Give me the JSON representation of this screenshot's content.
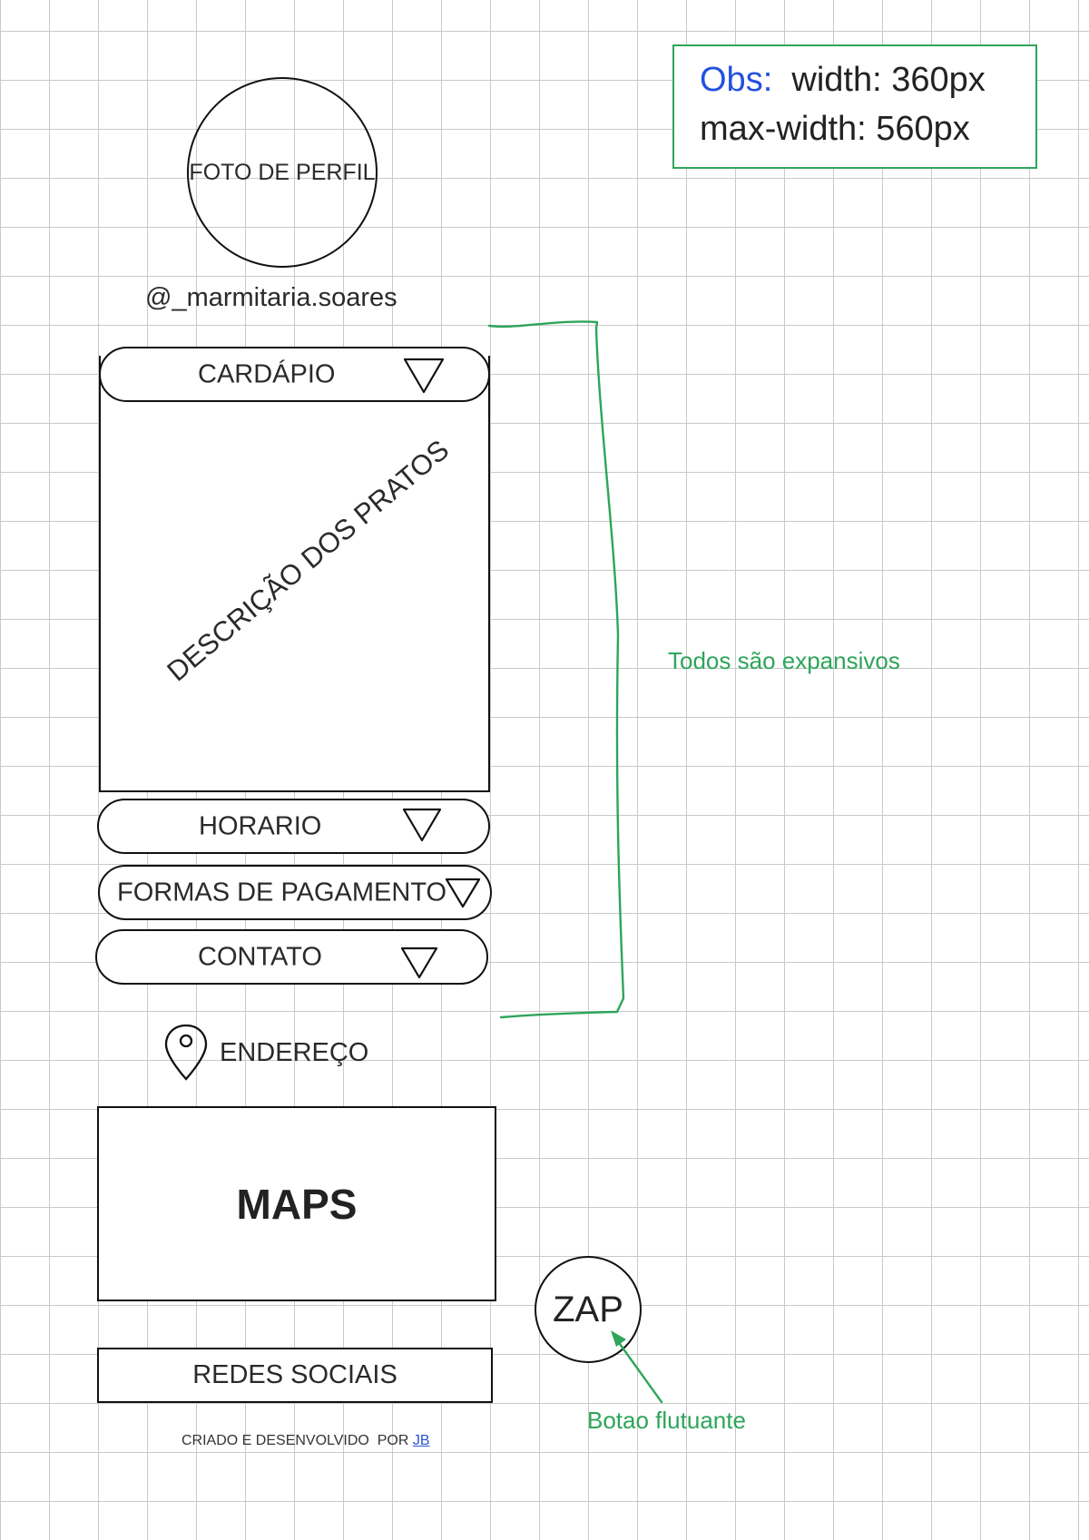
{
  "profile": {
    "photo_label": "FOTO DE PERFIL",
    "handle": "@_marmitaria.soares"
  },
  "accordion": [
    {
      "label": "CARDÁPIO",
      "content": "DESCRIÇÃO DOS PRATOS"
    },
    {
      "label": "HORARIO"
    },
    {
      "label": "FORMAS DE PAGAMENTO"
    },
    {
      "label": "CONTATO"
    }
  ],
  "address": {
    "label": "ENDEREÇO",
    "icon": "map-pin-icon"
  },
  "maps": {
    "label": "MAPS"
  },
  "social": {
    "label": "REDES SOCIAIS"
  },
  "footer": {
    "text": "CRIADO E DESENVOLVIDO  POR ",
    "link": "JB"
  },
  "floating_button": {
    "label": "ZAP"
  },
  "annotations": {
    "obs_label": "Obs:",
    "width": "width: 360px",
    "max_width": "max-width: 560px",
    "expand_note": "Todos são expansivos",
    "floating_note": "Botao flutuante"
  },
  "colors": {
    "annotation_green": "#2ea55a",
    "obs_blue": "#2251e0",
    "link_blue": "#2a54d6",
    "ink": "#111111"
  }
}
